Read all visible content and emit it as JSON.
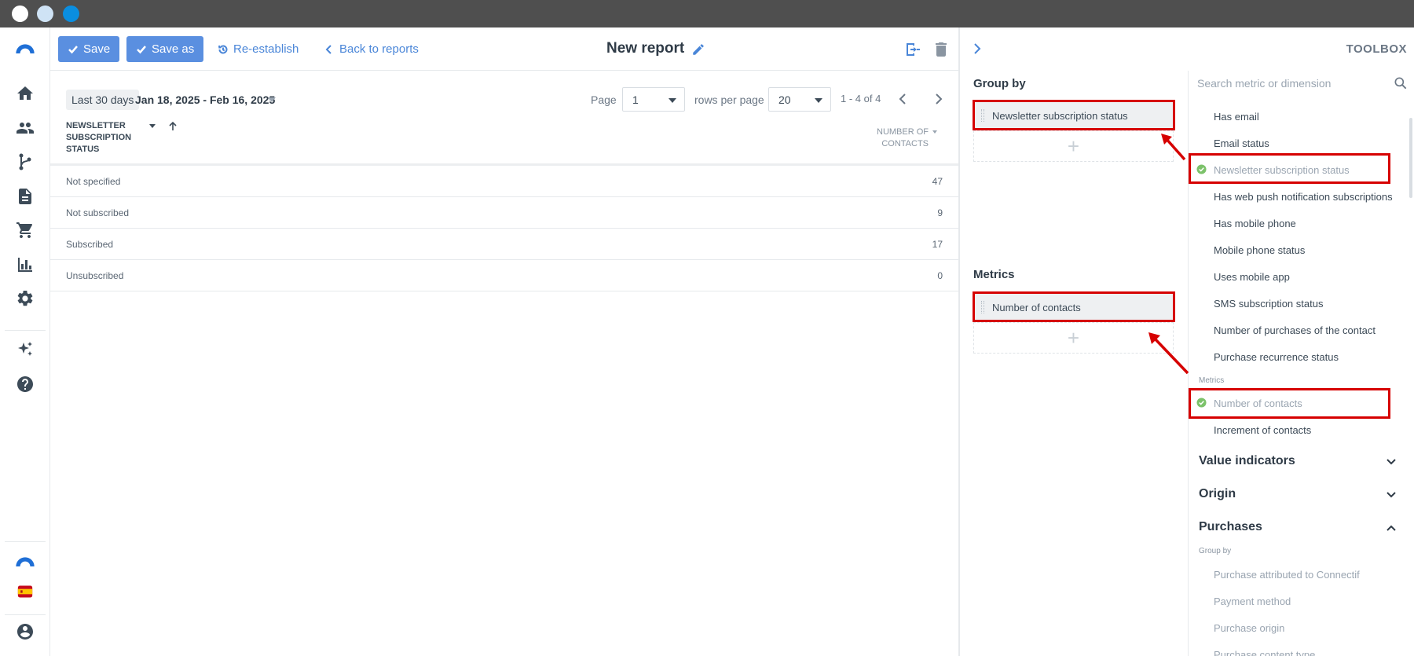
{
  "toolbar": {
    "save_label": "Save",
    "save_as_label": "Save as",
    "reestablish_label": "Re-establish",
    "back_label": "Back to reports",
    "title": "New report"
  },
  "filters": {
    "period_chip": "Last 30 days",
    "date_range": "Jan 18, 2025 - Feb 16, 2025",
    "page_label": "Page",
    "page_value": "1",
    "rows_label": "rows per page",
    "rows_value": "20",
    "range_info": "1 - 4 of 4"
  },
  "table": {
    "col1_header": [
      "NEWSLETTER",
      "SUBSCRIPTION",
      "STATUS"
    ],
    "col2_header": [
      "NUMBER OF",
      "CONTACTS"
    ],
    "rows": [
      {
        "label": "Not specified",
        "value": "47"
      },
      {
        "label": "Not subscribed",
        "value": "9"
      },
      {
        "label": "Subscribed",
        "value": "17"
      },
      {
        "label": "Unsubscribed",
        "value": "0"
      }
    ]
  },
  "panel": {
    "title": "TOOLBOX",
    "group_by_title": "Group by",
    "group_by_item": "Newsletter subscription status",
    "metrics_title": "Metrics",
    "metrics_item": "Number of contacts",
    "search_placeholder": "Search metric or dimension",
    "dimension_items": [
      "Has email",
      "Email status",
      "Newsletter subscription status",
      "Has web push notification subscriptions",
      "Has mobile phone",
      "Mobile phone status",
      "Uses mobile app",
      "SMS subscription status",
      "Number of purchases of the contact",
      "Purchase recurrence status"
    ],
    "metrics_sub_label": "Metrics",
    "metric_items": [
      "Number of contacts",
      "Increment of contacts"
    ],
    "sections": [
      "Value indicators",
      "Origin",
      "Purchases"
    ],
    "purchases_sub_label": "Group by",
    "purchase_items": [
      "Purchase attributed to Connectif",
      "Payment method",
      "Purchase origin",
      "Purchase content type"
    ]
  },
  "colors": {
    "primary_button": "#5a8fe0",
    "link": "#4a86d8",
    "highlight": "#d60000",
    "check": "#7cc26a"
  }
}
